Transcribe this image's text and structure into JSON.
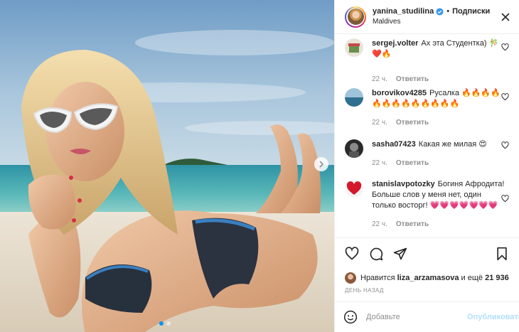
{
  "post": {
    "author": "yanina_studilina",
    "follow_label": "Подписки",
    "separator": "•",
    "location": "Maldives",
    "media_alt": "Фото: девушка в купальнике на пляже",
    "carousel": {
      "slides": 2,
      "active": 1
    }
  },
  "comments": [
    {
      "user": "sergej.volter",
      "text": "Ах эта Студентка) 🎋❤️🔥",
      "time": "22 ч.",
      "reply_label": "Ответить",
      "avatar": "gift-avatar"
    },
    {
      "user": "borovikov4285",
      "text": "Русалка 🔥🔥🔥🔥🔥🔥🔥🔥🔥🔥🔥🔥🔥",
      "time": "22 ч.",
      "reply_label": "Ответить",
      "avatar": "sea-avatar"
    },
    {
      "user": "sasha07423",
      "text": "Какая же милая 😍",
      "time": "22 ч.",
      "reply_label": "Ответить",
      "avatar": "dark-avatar"
    },
    {
      "user": "stanislavpotozky",
      "text": "Богиня Афродита! Больше слов у меня нет, один только восторг! 💗💗💗💗💗💗💗",
      "time": "22 ч.",
      "reply_label": "Ответить",
      "avatar": "heart-avatar"
    }
  ],
  "likes": {
    "prefix": "Нравится",
    "user": "liza_arzamasova",
    "middle": "и ещё",
    "count": "21 936"
  },
  "date_label": "ДЕНЬ НАЗАД",
  "composer": {
    "placeholder": "Добавьте",
    "publish_label": "Опубликовать"
  },
  "colors": {
    "accent": "#0095f6",
    "publish_disabled": "#b2dffc",
    "muted": "#8e8e8e",
    "heart_red": "#ed4956"
  }
}
